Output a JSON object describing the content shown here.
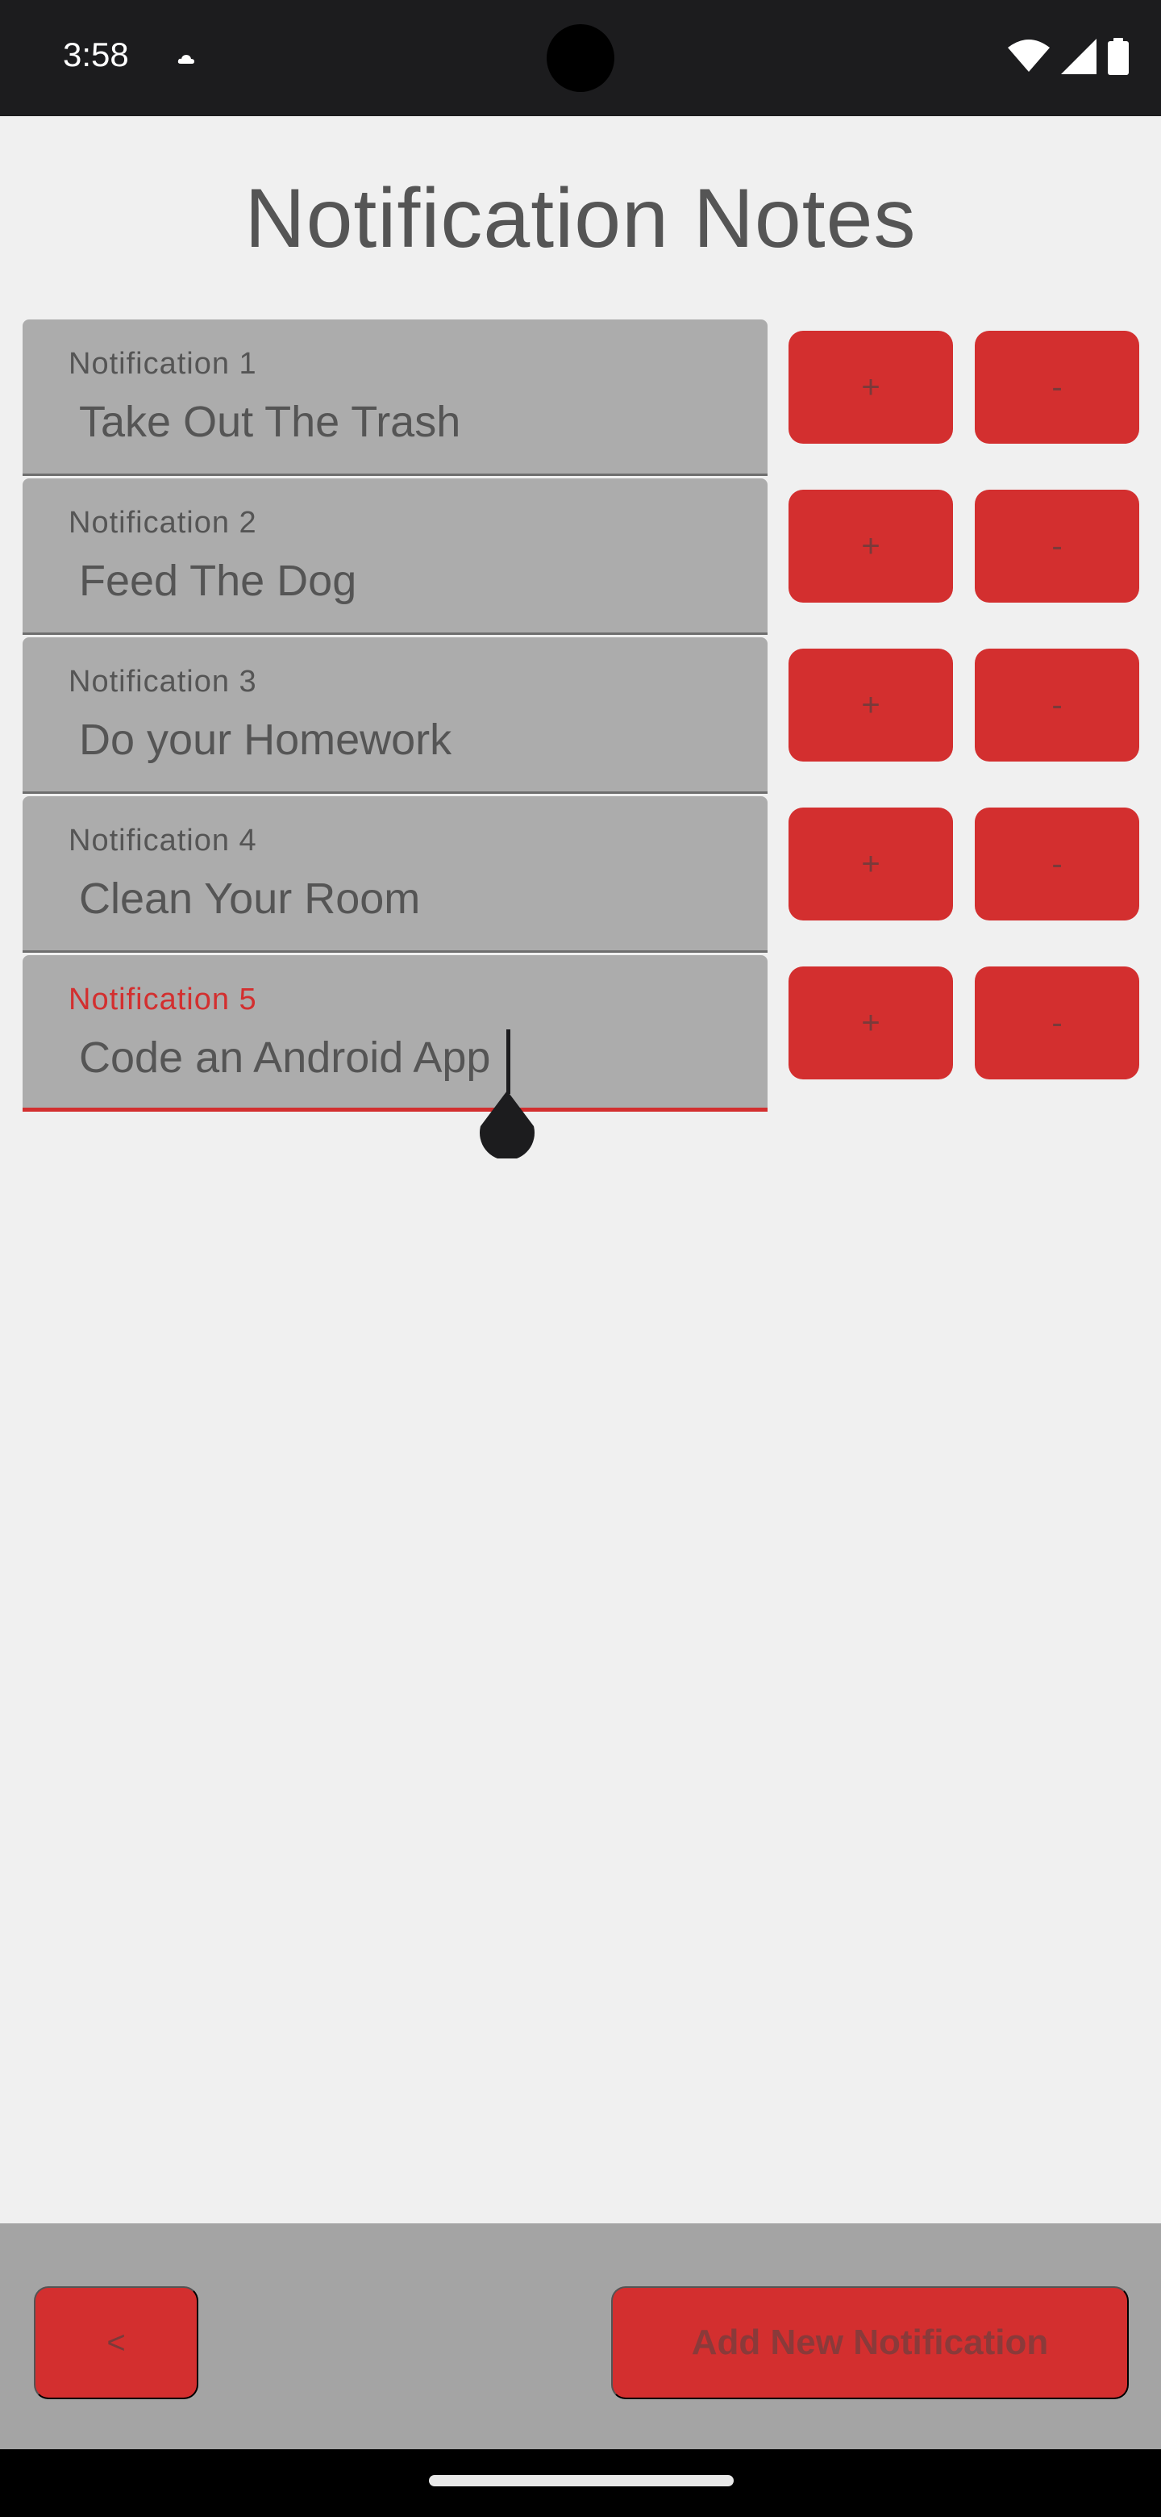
{
  "status_bar": {
    "time": "3:58"
  },
  "title": "Notification Notes",
  "notifications": [
    {
      "label": "Notification 1",
      "value": "Take Out The Trash",
      "plus": "+",
      "minus": "-"
    },
    {
      "label": "Notification 2",
      "value": "Feed The Dog",
      "plus": "+",
      "minus": "-"
    },
    {
      "label": "Notification 3",
      "value": "Do your Homework",
      "plus": "+",
      "minus": "-"
    },
    {
      "label": "Notification 4",
      "value": "Clean Your Room",
      "plus": "+",
      "minus": "-"
    },
    {
      "label": "Notification 5",
      "value": "Code an Android App",
      "plus": "+",
      "minus": "-"
    }
  ],
  "bottom": {
    "back_label": "<",
    "add_label": "Add New Notification"
  },
  "colors": {
    "accent": "#d32f2f",
    "field_bg": "#acacac",
    "background": "#f0f0f0"
  }
}
